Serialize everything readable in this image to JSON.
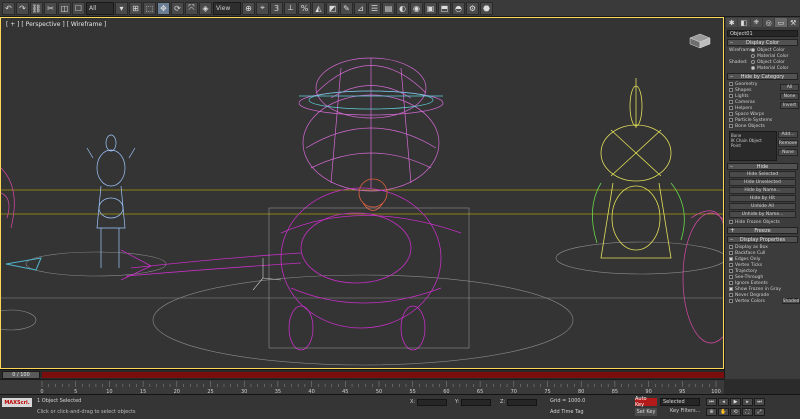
{
  "toolbar": {
    "buttons": [
      "↶",
      "↷",
      "⛓",
      "✂",
      "◫",
      "☐",
      "▾",
      "⊞",
      "⬚",
      "✥",
      "⟳",
      "⤧",
      "◈",
      "⊕",
      "⌖",
      "3",
      "⟂",
      "%",
      "◭",
      "◩",
      "✎",
      "⊿",
      "☰",
      "▤",
      "◐",
      "◉",
      "▣",
      "⬒",
      "◓",
      "⚙",
      "⬣"
    ],
    "dropdown_all": "All",
    "dropdown_view": "View"
  },
  "viewport": {
    "label": "[ + ] [ Perspective ] [ Wireframe ]",
    "cube_label": "LEFT"
  },
  "panel": {
    "tabs": [
      "✱",
      "◧",
      "⎈",
      "◎",
      "▭",
      "⚒"
    ],
    "object_name": "Object01",
    "display_color": {
      "title": "Display Color",
      "wireframe_label": "Wireframe:",
      "shaded_label": "Shaded:",
      "object_color": "Object Color",
      "material_color": "Material Color"
    },
    "hide_by_category": {
      "title": "Hide by Category",
      "items": [
        "Geometry",
        "Shapes",
        "Lights",
        "Cameras",
        "Helpers",
        "Space Warps",
        "Particle Systems",
        "Bone Objects"
      ],
      "all_btn": "All",
      "none_btn": "None",
      "invert_btn": "Invert",
      "filter_items": [
        "Bone",
        "IK Chain Object",
        "Point"
      ],
      "add_btn": "Add...",
      "remove_btn": "Remove",
      "none2_btn": "None"
    },
    "hide": {
      "title": "Hide",
      "buttons": [
        "Hide Selected",
        "Hide Unselected",
        "Hide by Name...",
        "Hide by Hit",
        "Unhide All",
        "Unhide by Name..."
      ],
      "frozen": "Hide Frozen Objects"
    },
    "freeze": {
      "title": "Freeze"
    },
    "display_properties": {
      "title": "Display Properties",
      "items": [
        "Display as Box",
        "Backface Cull",
        "Edges Only",
        "Vertex Ticks",
        "Trajectory",
        "See-Through",
        "Ignore Extents",
        "Show Frozen in Gray",
        "Never Degrade",
        "Vertex Colors"
      ],
      "checked": [
        false,
        false,
        true,
        false,
        false,
        false,
        false,
        true,
        false,
        false
      ],
      "shaded_btn": "Shaded"
    }
  },
  "timeline": {
    "thumb": "0 / 100",
    "ticks": [
      "0",
      "5",
      "10",
      "15",
      "20",
      "25",
      "30",
      "35",
      "40",
      "45",
      "50",
      "55",
      "60",
      "65",
      "70",
      "75",
      "80",
      "85",
      "90",
      "95",
      "100"
    ]
  },
  "status": {
    "logo": "MAXScri.",
    "selection": "1 Object Selected",
    "hint": "Click or click-and-drag to select objects",
    "x_label": "X:",
    "y_label": "Y:",
    "z_label": "Z:",
    "grid": "Grid = 1000.0",
    "add_time_tag": "Add Time Tag",
    "auto_key": "Auto Key",
    "set_key": "Set Key",
    "selected_dd": "Selected",
    "key_filters": "Key Filters...",
    "play_controls": [
      "⏮",
      "◂",
      "▶",
      "▸",
      "⏭"
    ],
    "nav_controls": [
      "⊕",
      "✋",
      "⟲",
      "⛶",
      "⤢"
    ]
  },
  "colors": {
    "accent_red": "#b31b1b",
    "viewport_border": "#fbd75a"
  }
}
